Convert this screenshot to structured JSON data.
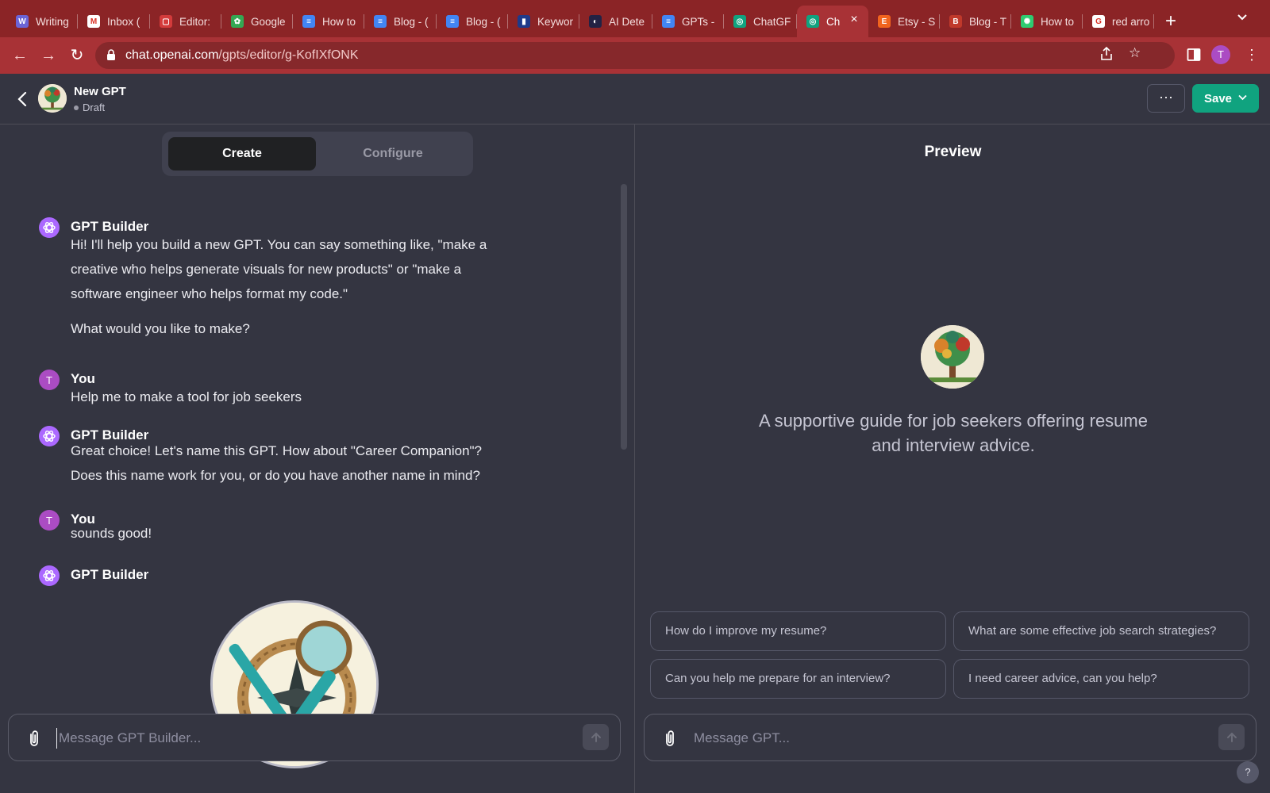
{
  "browser": {
    "tabs": [
      {
        "title": "Writing",
        "icon": "writing-icon",
        "color": "#6b64d6"
      },
      {
        "title": "Inbox (",
        "icon": "gmail-icon",
        "color": "#ffffff"
      },
      {
        "title": "Editor:",
        "icon": "editor-icon",
        "color": "#d33b3b"
      },
      {
        "title": "Google",
        "icon": "google-photos-icon",
        "color": "#34a853"
      },
      {
        "title": "How to",
        "icon": "docs-icon",
        "color": "#4285f4"
      },
      {
        "title": "Blog - (",
        "icon": "docs-icon",
        "color": "#4285f4"
      },
      {
        "title": "Blog - (",
        "icon": "docs-icon",
        "color": "#4285f4"
      },
      {
        "title": "Keywor",
        "icon": "keyword-icon",
        "color": "#1e3a8a"
      },
      {
        "title": "AI Dete",
        "icon": "ai-detect-icon",
        "color": "#222244"
      },
      {
        "title": "GPTs -",
        "icon": "docs-icon",
        "color": "#4285f4"
      },
      {
        "title": "ChatGF",
        "icon": "openai-icon",
        "color": "#10a37f"
      },
      {
        "title": "Ch",
        "icon": "openai-icon",
        "color": "#10a37f"
      },
      {
        "title": "Etsy - S",
        "icon": "etsy-icon",
        "color": "#f1641e"
      },
      {
        "title": "Blog - T",
        "icon": "blog-icon",
        "color": "#c0392b"
      },
      {
        "title": "How to",
        "icon": "howto-icon",
        "color": "#2ecc71"
      },
      {
        "title": "red arro",
        "icon": "google-icon",
        "color": "#ffffff"
      }
    ],
    "active_tab_index": 11,
    "url_domain": "chat.openai.com",
    "url_path": "/gpts/editor/g-KofIXfONK",
    "profile_initial": "T"
  },
  "header": {
    "gpt_name": "New GPT",
    "status": "Draft",
    "more_label": "···",
    "save_label": "Save"
  },
  "editor": {
    "tabs": {
      "create": "Create",
      "configure": "Configure"
    },
    "messages": [
      {
        "author": "GPT Builder",
        "role": "gpt",
        "text": "Hi! I'll help you build a new GPT. You can say something like, \"make a creative who helps generate visuals for new products\" or \"make a software engineer who helps format my code.\"",
        "text2": "What would you like to make?"
      },
      {
        "author": "You",
        "role": "user",
        "text": "Help me to make a tool for job seekers"
      },
      {
        "author": "GPT Builder",
        "role": "gpt",
        "text": "Great choice! Let's name this GPT. How about \"Career Companion\"? Does this name work for you, or do you have another name in mind?"
      },
      {
        "author": "You",
        "role": "user",
        "text": "sounds good!"
      },
      {
        "author": "GPT Builder",
        "role": "gpt",
        "text": ""
      }
    ],
    "user_initial": "T",
    "composer_placeholder": "Message GPT Builder..."
  },
  "preview": {
    "title": "Preview",
    "description": "A supportive guide for job seekers offering resume and interview advice.",
    "suggestions": [
      "How do I improve my resume?",
      "What are some effective job search strategies?",
      "Can you help me prepare for an interview?",
      "I need career advice, can you help?"
    ],
    "composer_placeholder": "Message GPT...",
    "help_label": "?"
  }
}
